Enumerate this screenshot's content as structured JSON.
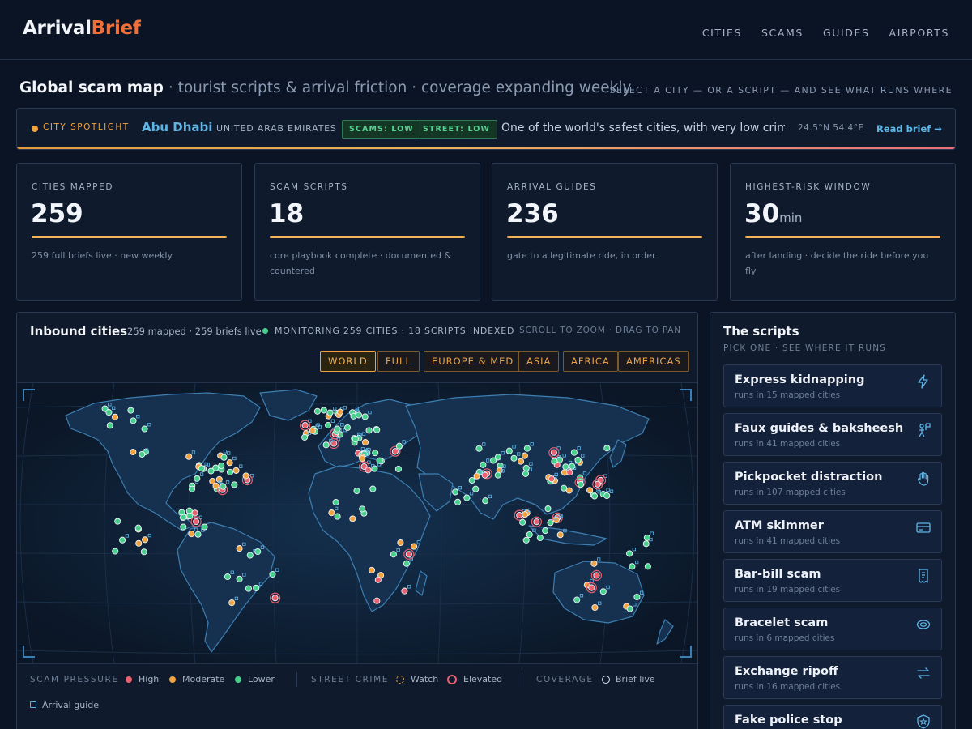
{
  "header": {
    "brand_part1": "Arrival",
    "brand_part2": "Brief",
    "nav": [
      "CITIES",
      "SCAMS",
      "GUIDES",
      "AIRPORTS"
    ]
  },
  "title": {
    "main": "Global scam map",
    "sub": " · tourist scripts & arrival friction · coverage expanding weekly",
    "hint": "SELECT A CITY — OR A SCRIPT — AND SEE WHAT RUNS WHERE"
  },
  "spotlight": {
    "label": "CITY SPOTLIGHT",
    "city": "Abu Dhabi",
    "country": "UNITED ARAB EMIRATES",
    "badge_scams": "SCAMS: LOW",
    "badge_street": "STREET: LOW",
    "description": "One of the world's safest cities, with very low crim...",
    "coords": "24.5°N 54.4°E",
    "link": "Read brief →"
  },
  "stats": [
    {
      "label": "CITIES MAPPED",
      "value": "259",
      "unit": "",
      "sub": "259 full briefs live · new weekly"
    },
    {
      "label": "SCAM SCRIPTS",
      "value": "18",
      "unit": "",
      "sub": "core playbook complete · documented & countered"
    },
    {
      "label": "ARRIVAL GUIDES",
      "value": "236",
      "unit": "",
      "sub": "gate to a legitimate ride, in order"
    },
    {
      "label": "HIGHEST-RISK WINDOW",
      "value": "30",
      "unit": "min",
      "sub": "after landing · decide the ride before you fly"
    }
  ],
  "map": {
    "title": "Inbound cities",
    "meta": "259 mapped · 259 briefs live",
    "monitoring": "MONITORING 259 CITIES · 18 SCRIPTS INDEXED",
    "hint": "SCROLL TO ZOOM · DRAG TO PAN",
    "regions": [
      "WORLD",
      "FULL",
      "EUROPE & MED",
      "ASIA",
      "AFRICA",
      "AMERICAS"
    ],
    "active_region": "WORLD",
    "colors": {
      "high": "#e9606f",
      "moderate": "#f1a340",
      "lower": "#47d08c",
      "guide": "#5fb6e6"
    }
  },
  "legend": {
    "scam_pressure": "SCAM PRESSURE",
    "high": "High",
    "moderate": "Moderate",
    "lower": "Lower",
    "street_crime": "STREET CRIME",
    "watch": "Watch",
    "elevated": "Elevated",
    "coverage": "COVERAGE",
    "brief_live": "Brief live",
    "arrival_guide": "Arrival guide"
  },
  "scripts": {
    "title": "The scripts",
    "subtitle": "PICK ONE · SEE WHERE IT RUNS",
    "items": [
      {
        "name": "Express kidnapping",
        "runs": "runs in 15 mapped cities",
        "icon": "lightning-icon"
      },
      {
        "name": "Faux guides & baksheesh",
        "runs": "runs in 41 mapped cities",
        "icon": "guide-flag-icon"
      },
      {
        "name": "Pickpocket distraction",
        "runs": "runs in 107 mapped cities",
        "icon": "hand-icon"
      },
      {
        "name": "ATM skimmer",
        "runs": "runs in 41 mapped cities",
        "icon": "card-icon"
      },
      {
        "name": "Bar-bill scam",
        "runs": "runs in 19 mapped cities",
        "icon": "receipt-icon"
      },
      {
        "name": "Bracelet scam",
        "runs": "runs in 6 mapped cities",
        "icon": "bracelet-icon"
      },
      {
        "name": "Exchange ripoff",
        "runs": "runs in 16 mapped cities",
        "icon": "exchange-icon"
      },
      {
        "name": "Fake police stop",
        "runs": "",
        "icon": "badge-icon"
      }
    ]
  }
}
